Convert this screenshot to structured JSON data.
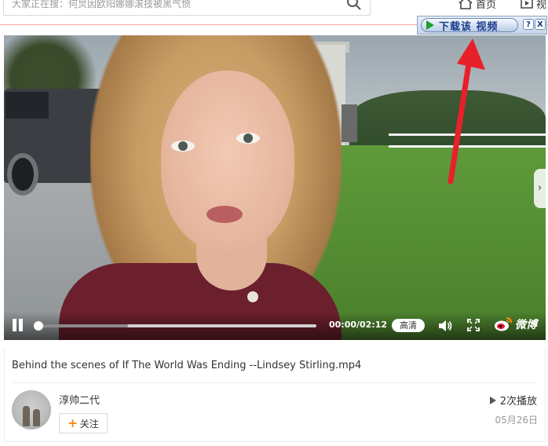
{
  "search": {
    "placeholder": "大家正在搜：何炅因欧阳娜娜滚技被黑气愤"
  },
  "nav": {
    "home_label": "首页",
    "video_label": "视"
  },
  "download_bar": {
    "button_label": "下载该 视频",
    "help_label": "?",
    "close_label": "X"
  },
  "player": {
    "time": "00:00/02:12",
    "progress": 0,
    "quality_label": "高清",
    "weibo_label": "微博",
    "side_arrow": "›"
  },
  "video": {
    "title": "Behind the scenes of If The World Was Ending --Lindsey Stirling.mp4",
    "author": "淳帅二代",
    "follow_label": "关注",
    "follow_plus": "+",
    "play_count": "2次播放",
    "date": "05月26日"
  },
  "colors": {
    "accent_orange": "#ff8200",
    "annotation_red": "#e8202a",
    "download_text": "#1a3b8b"
  }
}
